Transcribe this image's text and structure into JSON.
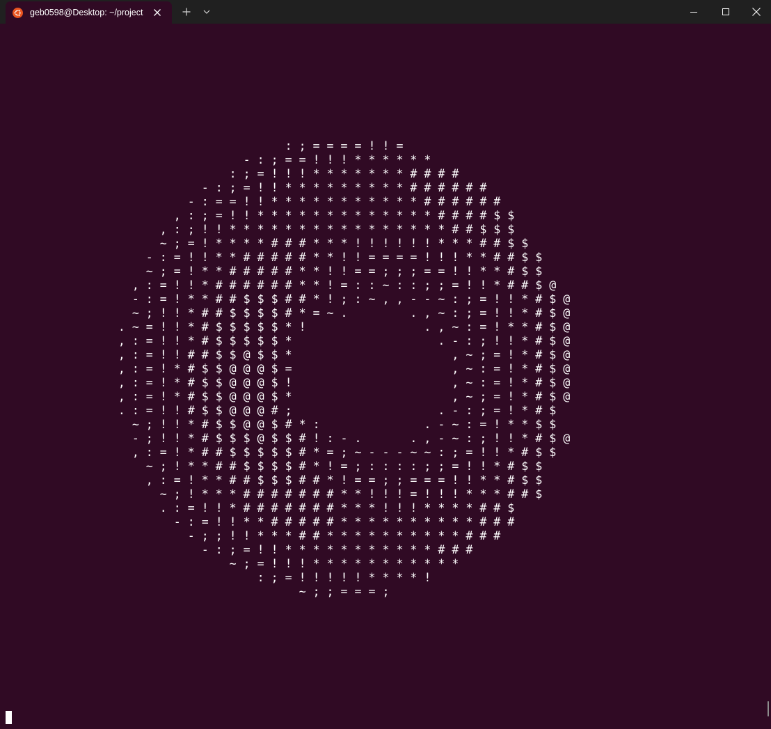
{
  "window": {
    "tab_title": "geb0598@Desktop: ~/project",
    "icons": {
      "tab_icon": "ubuntu-logo-icon",
      "tab_close": "close-icon",
      "new_tab": "plus-icon",
      "tab_dropdown": "chevron-down-icon",
      "minimize": "minimize-icon",
      "maximize": "maximize-icon",
      "close": "close-icon"
    }
  },
  "colors": {
    "terminal_background": "#300a24",
    "titlebar_background": "#202020",
    "ubuntu_orange": "#e95420",
    "text": "#ffffff"
  },
  "terminal": {
    "output": "                                         : ; = = = = ! ! =\n                                   - : ; = = ! ! ! * * * * * *\n                                 : ; = ! ! ! * * * * * * * # # # #\n                             - : ; = ! ! * * * * * * * * * # # # # # #\n                           - : = = ! ! * * * * * * * * * * * # # # # # #\n                         , : ; = ! ! * * * * * * * * * * * * * # # # # $ $\n                       , : ; ! ! * * * * * * * * * * * * * * * * # # $ $ $\n                       ~ ; = ! * * * * # # # * * * ! ! ! ! ! ! * * * # # $ $\n                     - : = ! ! * * # # # # # * * ! ! = = = = ! ! ! * * # # $ $\n                     ~ ; = ! * * # # # # # * * ! ! = = ; ; ; = = ! ! * * # $ $\n                   , : = ! ! * # # # # # # * * ! = : : ~ : : ; ; = ! ! * # # $ @\n                   - : = ! * * # # $ $ $ # # * ! ; : ~ , , - - ~ : ; = ! ! * # $ @\n                   ~ ; ! ! * # # $ $ $ $ # * = ~ .         . , ~ : ; = ! ! * # $ @\n                 . ~ = ! ! * # $ $ $ $ $ * !                 . , ~ : = ! * * # $ @\n                 , : = ! ! * # $ $ $ $ $ *                     . - : ; ! ! * # $ @\n                 , : = ! ! # # $ $ @ $ $ *                       , ~ ; = ! * # $ @\n                 , : = ! * # $ $ @ @ @ $ =                       , ~ : = ! * # $ @\n                 , : = ! * # $ $ @ @ @ $ !                       , ~ : = ! * # $ @\n                 , : = ! * # $ $ @ @ @ $ *                       , ~ ; = ! * # $ @\n                 . : = ! ! # $ $ @ @ @ # ;                     . - : ; = ! * # $\n                   ~ ; ! ! * # $ $ @ @ $ # * :               . - ~ : = ! * * $ $\n                   - ; ! ! * # $ $ $ @ $ $ # ! : - .       . , - ~ : ; ! ! * # $ @\n                   , : = ! * # # $ $ $ $ $ # * = ; ~ - - - ~ ~ : ; = ! ! * # $ $\n                     ~ ; ! * * # # $ $ $ $ # * ! = ; : : : : ; ; = ! ! * # $ $\n                     , : = ! * * # # $ $ $ # # * ! = = ; ; = = = ! ! * * # $ $\n                       ~ ; ! * * * # # # # # # # * * ! ! ! = ! ! ! * * * # # $\n                       . : = ! ! * # # # # # # # * * * ! ! ! * * * * # # $\n                         - : = ! ! * * # # # # # * * * * * * * * * * # # #\n                           - ; ; ! ! * * * # # * * * * * * * * * * # # #\n                             - : ; = ! ! * * * * * * * * * * * # # #\n                                 ~ ; = ! ! ! * * * * * * * * * * *\n                                     : ; = ! ! ! ! ! * * * * !\n                                           ~ ; ; = = = ;"
  }
}
